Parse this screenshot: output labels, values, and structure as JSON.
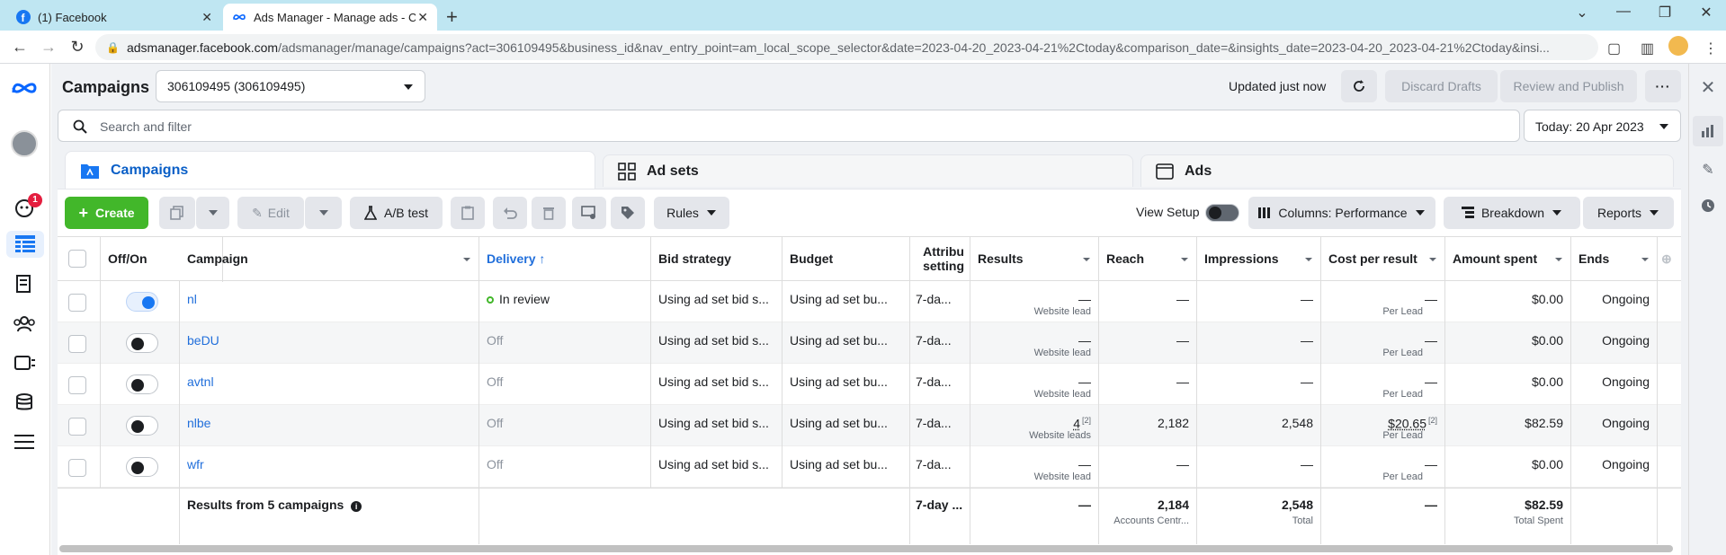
{
  "browser": {
    "tabs": [
      {
        "title": "(1) Facebook"
      },
      {
        "title": "Ads Manager - Manage ads - Ca"
      }
    ],
    "url_host": "adsmanager.facebook.com",
    "url_path": "/adsmanager/manage/campaigns?act=306109495&business_id&nav_entry_point=am_local_scope_selector&date=2023-04-20_2023-04-21%2Ctoday&comparison_date=&insights_date=2023-04-20_2023-04-21%2Ctoday&insi..."
  },
  "leftnav": {
    "notification_count": "1"
  },
  "header": {
    "title": "Campaigns",
    "account": "306109495 (306109495)",
    "updated": "Updated just now",
    "discard_label": "Discard Drafts",
    "review_label": "Review and Publish"
  },
  "search": {
    "placeholder": "Search and filter"
  },
  "date": {
    "label": "Today: 20 Apr 2023"
  },
  "level_tabs": [
    {
      "label": "Campaigns"
    },
    {
      "label": "Ad sets"
    },
    {
      "label": "Ads"
    }
  ],
  "toolbar": {
    "create": "Create",
    "edit": "Edit",
    "ab_test": "A/B test",
    "rules": "Rules",
    "view_setup": "View Setup",
    "columns": "Columns: Performance",
    "breakdown": "Breakdown",
    "reports": "Reports"
  },
  "table": {
    "headers": {
      "offon": "Off/On",
      "campaign": "Campaign",
      "delivery": "Delivery",
      "bid": "Bid strategy",
      "budget": "Budget",
      "attrib1": "Attribu",
      "attrib2": "setting",
      "results": "Results",
      "reach": "Reach",
      "impressions": "Impressions",
      "cpr": "Cost per result",
      "spent": "Amount spent",
      "ends": "Ends"
    },
    "rows": [
      {
        "name": "nl",
        "on": true,
        "delivery": "In review",
        "bid": "Using ad set bid s...",
        "budget": "Using ad set bu...",
        "attrib": "7-da...",
        "results": "—",
        "results_sub": "Website lead",
        "reach": "—",
        "impr": "—",
        "cpr": "—",
        "cpr_sub": "Per Lead",
        "spent": "$0.00",
        "ends": "Ongoing"
      },
      {
        "name": "beDU",
        "on": false,
        "delivery": "Off",
        "bid": "Using ad set bid s...",
        "budget": "Using ad set bu...",
        "attrib": "7-da...",
        "results": "—",
        "results_sub": "Website lead",
        "reach": "—",
        "impr": "—",
        "cpr": "—",
        "cpr_sub": "Per Lead",
        "spent": "$0.00",
        "ends": "Ongoing"
      },
      {
        "name": "avtnl",
        "on": false,
        "delivery": "Off",
        "bid": "Using ad set bid s...",
        "budget": "Using ad set bu...",
        "attrib": "7-da...",
        "results": "—",
        "results_sub": "Website lead",
        "reach": "—",
        "impr": "—",
        "cpr": "—",
        "cpr_sub": "Per Lead",
        "spent": "$0.00",
        "ends": "Ongoing"
      },
      {
        "name": "nlbe",
        "on": false,
        "delivery": "Off",
        "bid": "Using ad set bid s...",
        "budget": "Using ad set bu...",
        "attrib": "7-da...",
        "results": "4",
        "results_sup": "[2]",
        "results_sub": "Website leads",
        "reach": "2,182",
        "impr": "2,548",
        "cpr": "$20.65",
        "cpr_sup": "[2]",
        "cpr_sub": "Per Lead",
        "spent": "$82.59",
        "ends": "Ongoing"
      },
      {
        "name": "wfr",
        "on": false,
        "delivery": "Off",
        "bid": "Using ad set bid s...",
        "budget": "Using ad set bu...",
        "attrib": "7-da...",
        "results": "—",
        "results_sub": "Website lead",
        "reach": "—",
        "impr": "—",
        "cpr": "—",
        "cpr_sub": "Per Lead",
        "spent": "$0.00",
        "ends": "Ongoing"
      }
    ],
    "footer": {
      "label": "Results from 5 campaigns",
      "attrib": "7-day ...",
      "results": "—",
      "reach": "2,184",
      "reach_sub": "Accounts Centr...",
      "impr": "2,548",
      "impr_sub": "Total",
      "cpr": "—",
      "spent": "$82.59",
      "spent_sub": "Total Spent"
    }
  },
  "colors": {
    "accent": "#1877f2",
    "create": "#42b72a",
    "link": "#216fdb"
  }
}
